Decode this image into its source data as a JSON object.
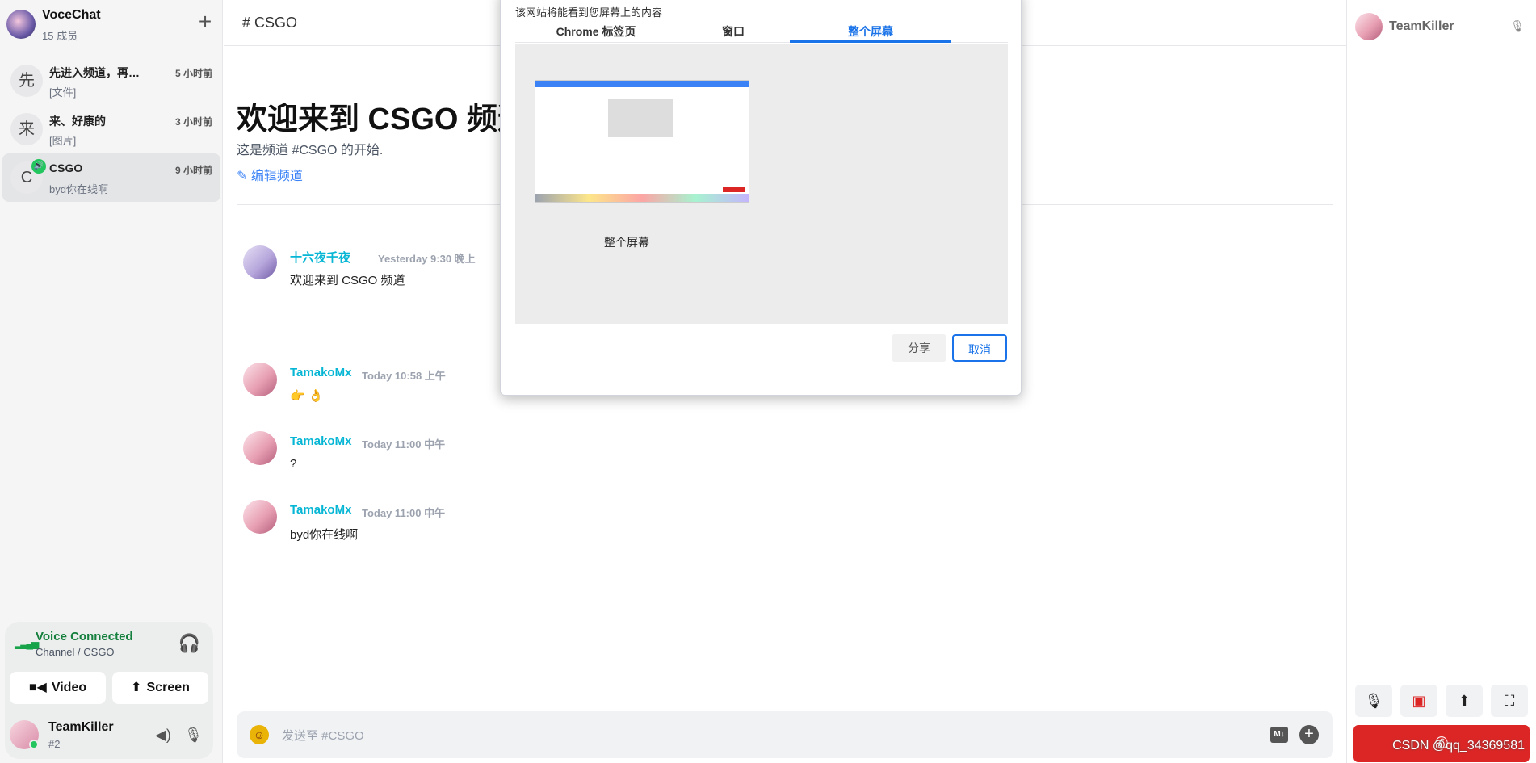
{
  "workspace": {
    "name": "VoceChat",
    "member_count": "15 成员",
    "add_icon": "plus-icon"
  },
  "channels": [
    {
      "avatar": "先",
      "name": "先进入频道，再…",
      "time": "5 小时前",
      "preview": "[文件]"
    },
    {
      "avatar": "来",
      "name": "来、好康的",
      "time": "3 小时前",
      "preview": "[图片]"
    },
    {
      "avatar": "C",
      "name": "CSGO",
      "time": "9 小时前",
      "preview": "byd你在线啊",
      "active": true
    }
  ],
  "voice": {
    "status": "Voice Connected",
    "channel": "Channel / CSGO",
    "video_label": "Video",
    "screen_label": "Screen",
    "user_name": "TeamKiller",
    "user_id": "#2"
  },
  "header": {
    "title": "# CSGO"
  },
  "welcome": {
    "title": "欢迎来到 CSGO 频道",
    "subtitle": "这是频道 #CSGO 的开始.",
    "edit_label": "编辑频道"
  },
  "messages": [
    {
      "author": "十六夜千夜",
      "time": "Yesterday 9:30 晚上",
      "text": "欢迎来到 CSGO 频道"
    },
    {
      "author": "TamakoMx",
      "time": "Today 10:58 上午",
      "text": "👉 👌"
    },
    {
      "author": "TamakoMx",
      "time": "Today 11:00 中午",
      "text": "?"
    },
    {
      "author": "TamakoMx",
      "time": "Today 11:00 中午",
      "text": "byd你在线啊"
    }
  ],
  "composer": {
    "placeholder": "发送至 #CSGO",
    "md_label": "M↓"
  },
  "right_panel": {
    "user_name": "TeamKiller",
    "watermark": "CSDN @qq_34369581"
  },
  "share_dialog": {
    "title": "该网站将能看到您屏幕上的内容",
    "tabs": [
      "Chrome 标签页",
      "窗口",
      "整个屏幕"
    ],
    "selected_tab": "整个屏幕",
    "thumbnail_label": "整个屏幕",
    "share_label": "分享",
    "cancel_label": "取消"
  },
  "colors": {
    "accent": "#1a73e8",
    "online": "#22c55e",
    "danger": "#dc2626",
    "author": "#06b6d4"
  }
}
